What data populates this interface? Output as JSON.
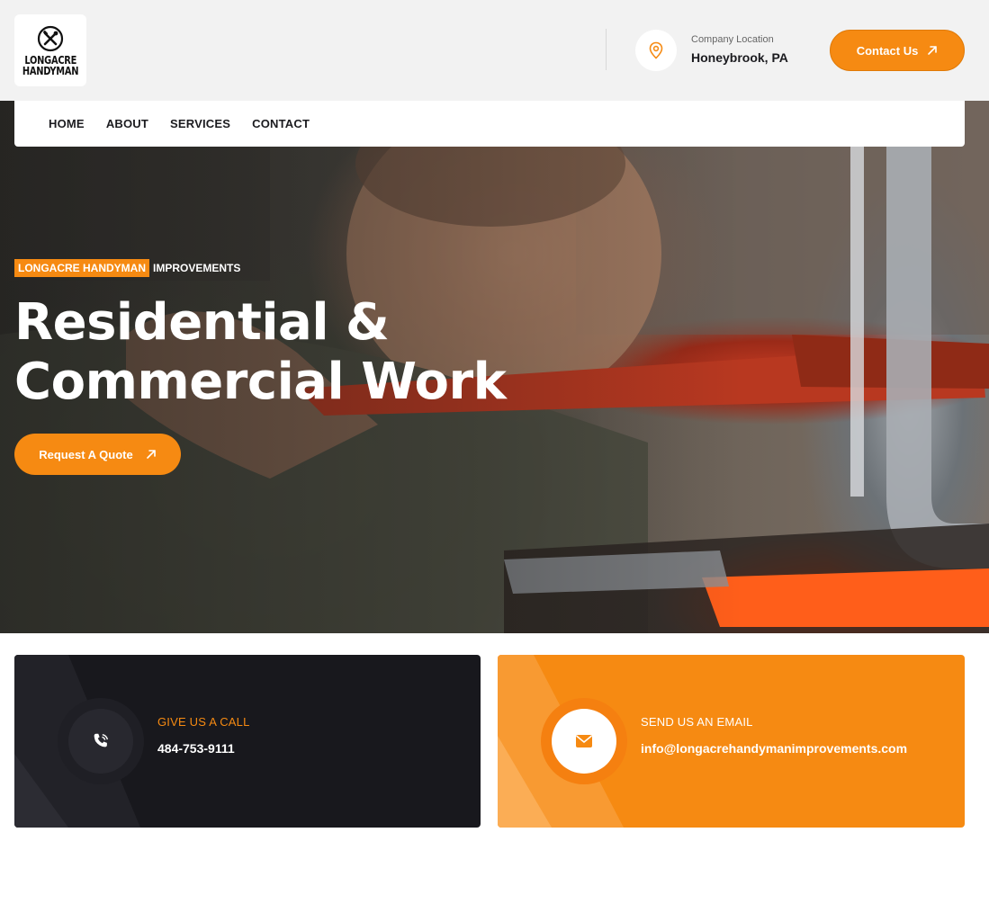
{
  "brand": {
    "logo_line1": "LONGACRE",
    "logo_line2": "HANDYMAN"
  },
  "topbar": {
    "location_label": "Company Location",
    "location_value": "Honeybrook, PA",
    "contact_button": "Contact Us"
  },
  "nav": {
    "items": [
      "HOME",
      "ABOUT",
      "SERVICES",
      "CONTACT"
    ]
  },
  "hero": {
    "tag_highlight": "LONGACRE HANDYMAN",
    "tag_rest": "IMPROVEMENTS",
    "headline_line1": "Residential &",
    "headline_line2": "Commercial Work",
    "cta_button": "Request A Quote"
  },
  "cards": {
    "call": {
      "label": "GIVE US A CALL",
      "value": "484-753-9111",
      "icon": "phone-icon"
    },
    "email": {
      "label": "SEND US AN EMAIL",
      "value": "info@longacrehandymanimprovements.com",
      "icon": "envelope-icon"
    }
  },
  "colors": {
    "accent": "#f68a12",
    "dark": "#18181d",
    "topbar_bg": "#f2f2f2"
  }
}
